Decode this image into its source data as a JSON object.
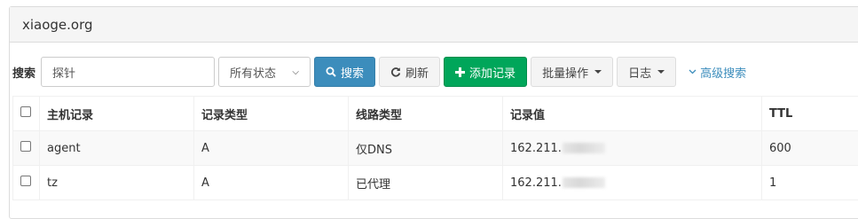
{
  "panel": {
    "title": "xiaoge.org"
  },
  "toolbar": {
    "search_label": "搜索",
    "search_value": "探针",
    "status_select": "所有状态",
    "search_button": "搜索",
    "refresh_button": "刷新",
    "add_button": "添加记录",
    "batch_button": "批量操作",
    "log_button": "日志",
    "advanced_link": "高级搜索"
  },
  "table": {
    "headers": [
      "主机记录",
      "记录类型",
      "线路类型",
      "记录值",
      "TTL"
    ],
    "rows": [
      {
        "host": "agent",
        "type": "A",
        "line": "仅DNS",
        "value": "162.211.",
        "ttl": "600"
      },
      {
        "host": "tz",
        "type": "A",
        "line": "已代理",
        "value": "162.211.",
        "ttl": "1"
      }
    ]
  }
}
